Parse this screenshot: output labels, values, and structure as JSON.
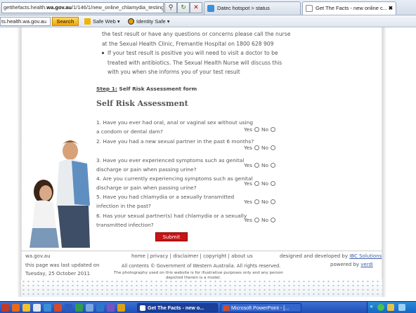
{
  "browser": {
    "address_prefix": "getthefacts.health.",
    "address_domain": "wa.gov.au",
    "address_path": "/1/146/1/new_online_chlamydia_testing.pm",
    "search_icon": "magnifier-icon",
    "tabs": [
      {
        "label": "Datec hotspot > status",
        "active": false
      },
      {
        "label": "Get The Facts - new online c...",
        "active": true
      }
    ],
    "close_tab_symbol": "✖"
  },
  "toolbar": {
    "search_value": "ts.health.wa.gov.au",
    "search_button": "Search",
    "safe_web": "Safe Web ▾",
    "identity_safe": "Identity Safe ▾"
  },
  "content": {
    "para1": "the test result or have any questions or concerns please call the nurse at the Sexual Health Clinic, Fremantle Hospital on 1800 628 909",
    "para2": "If your test result is positive you will need to visit a doctor to be treated with antibiotics. The Sexual Health Nurse will discuss this with you when she informs you of your test result",
    "step_prefix": "Step 1:",
    "step_rest": " Self Risk Assessment form",
    "heading": "Self Risk Assessment",
    "yes": "Yes",
    "no": "No",
    "questions": [
      "1. Have you ever had oral, anal or vaginal sex without using a condom or dental dam?",
      "2. Have you had a new sexual partner in the past 6 months?",
      "3. Have you ever experienced symptoms such as genital discharge or pain when passing urine?",
      "4. Are you currently experiencing symptoms such as genital discharge or pain when passing urine?",
      "5. Have you had chlamydia or a sexually transmitted infection in the past?",
      "6. Has your sexual partner(s) had chlamydia or a sexually transmitted infection?"
    ],
    "submit": "Submit"
  },
  "footer": {
    "site": "wa.gov.au",
    "updated_label": "this page was last updated on",
    "updated_date": "Tuesday, 25 October 2011",
    "links": [
      "home",
      "privacy",
      "disclaimer",
      "copyright",
      "about us"
    ],
    "separator": "|",
    "contents": "All contents © Government of Western Australia. All rights reserved.",
    "disclaimer_line1": "The photography used on this website is for illustrative purposes only and any person",
    "disclaimer_line2": "depicted therein is a model.",
    "designed_prefix": "designed and developed by ",
    "designer": "IBC Solutions",
    "powered_prefix": "powered by ",
    "powered": "verdi"
  },
  "taskbar": {
    "tasks": [
      {
        "label": "Get The Facts - new o...",
        "active": true
      },
      {
        "label": "Microsoft PowerPoint - [...",
        "active": false
      }
    ],
    "tray_text": "«"
  },
  "colors": {
    "accent_red": "#c81414",
    "link_blue": "#3b5ea8",
    "taskbar_blue": "#1f4fb6"
  }
}
